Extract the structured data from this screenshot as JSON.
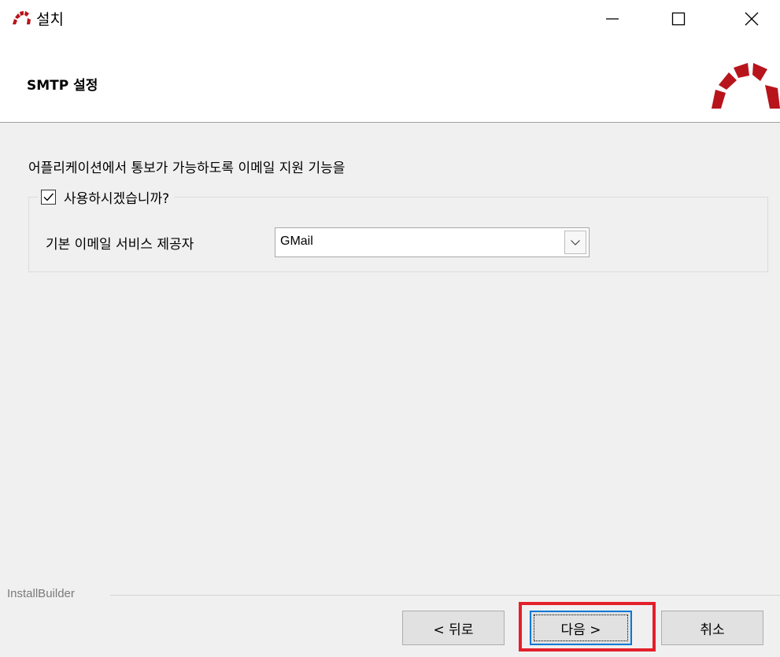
{
  "window": {
    "title": "설치",
    "controls": {
      "minimize": "minimize-icon",
      "maximize": "maximize-icon",
      "close": "close-icon"
    }
  },
  "header": {
    "title": "SMTP 설정",
    "logo": "installer-logo-icon"
  },
  "content": {
    "intro": "어플리케이션에서 통보가 가능하도록 이메일 지원 기능을",
    "enable_checkbox": {
      "label": "사용하시겠습니까?",
      "checked": true
    },
    "provider": {
      "label": "기본 이메일 서비스 제공자",
      "value": "GMail"
    }
  },
  "footer": {
    "brand": "InstallBuilder",
    "back_label": "< 뒤로",
    "next_label": "다음 >",
    "cancel_label": "취소"
  },
  "colors": {
    "logo_red": "#b8141c",
    "highlight_red": "#e3202a",
    "focus_blue": "#0078d7"
  }
}
